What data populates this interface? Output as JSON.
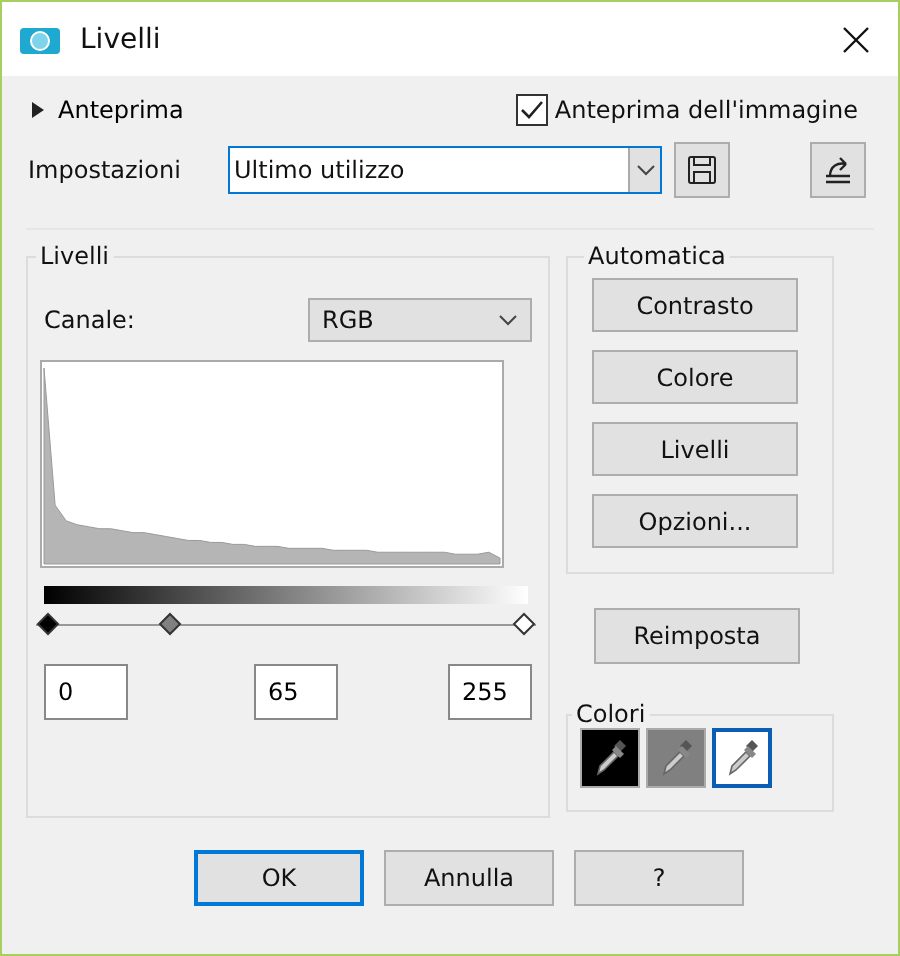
{
  "window": {
    "title": "Livelli"
  },
  "preview": {
    "label": "Anteprima",
    "expanded": false
  },
  "image_preview": {
    "label": "Anteprima dell'immagine",
    "checked": true
  },
  "settings": {
    "label": "Impostazioni",
    "value": "Ultimo utilizzo"
  },
  "levels_group": {
    "title": "Livelli",
    "channel_label": "Canale:",
    "channel_value": "RGB",
    "sliders": [
      {
        "level": 0,
        "color": "#000000"
      },
      {
        "level": 0.255,
        "color": "#808080"
      },
      {
        "level": 1,
        "color": "#ffffff"
      }
    ],
    "inputs": [
      "0",
      "65",
      "255"
    ]
  },
  "auto_group": {
    "title": "Automatica",
    "buttons": [
      "Contrasto",
      "Colore",
      "Livelli",
      "Opzioni..."
    ]
  },
  "reset_button": "Reimposta",
  "colors_group": {
    "title": "Colori",
    "droppers": [
      {
        "color": "#000000",
        "selected": false
      },
      {
        "color": "#808080",
        "selected": false
      },
      {
        "color": "#ffffff",
        "selected": true
      }
    ]
  },
  "buttons": [
    {
      "label": "OK",
      "default": true
    },
    {
      "label": "Annulla",
      "default": false
    },
    {
      "label": "?",
      "default": false
    }
  ]
}
